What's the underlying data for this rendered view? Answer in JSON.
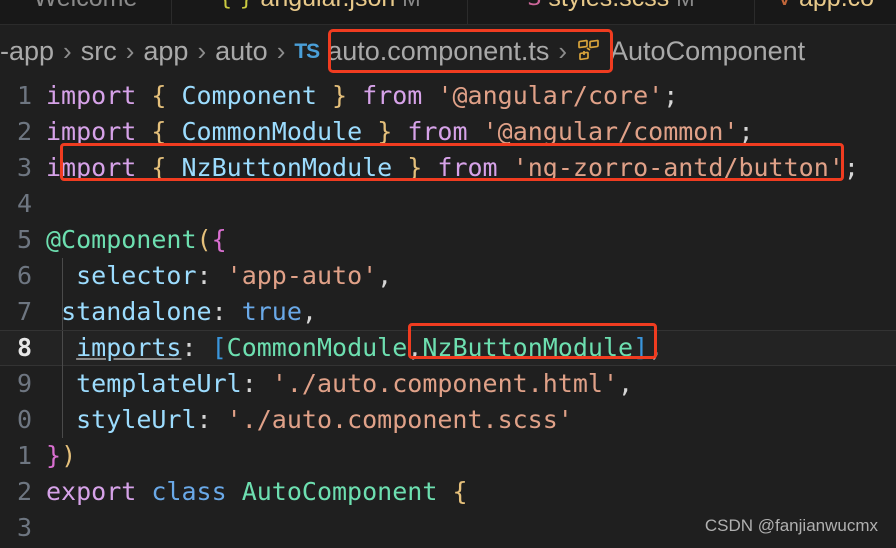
{
  "theme": {
    "editor_background": "#1f1f1f",
    "tabbar_background": "#181818",
    "highlight_box_color": "#f03c20",
    "current_line_background": "#232323",
    "keyword_color": "#d6a2e8",
    "type_color": "#6ddfb0",
    "string_color": "#e0a188",
    "identifier_color": "#9cdcfe",
    "brace_color": "#e5c07b",
    "bracket_color": "#3a96dd",
    "linenumber_color": "#6e7681"
  },
  "tabs": [
    {
      "label": "Welcome",
      "icon": "",
      "dirty": "",
      "active": false
    },
    {
      "label": "angular.json",
      "icon": "{ }",
      "dirty": "M",
      "active": false
    },
    {
      "label": "styles.scss",
      "icon": "S",
      "dirty": "M",
      "active": false
    },
    {
      "label": "app.co",
      "icon": "V",
      "dirty": "",
      "active": false
    }
  ],
  "breadcrumb": {
    "items": [
      "-app",
      "src",
      "app",
      "auto"
    ],
    "separator": "›",
    "file": {
      "badge": "TS",
      "name": "auto.component.ts"
    },
    "symbol": {
      "icon": "component-icon",
      "name": "AutoComponent"
    }
  },
  "code": {
    "lines": [
      {
        "n": "1",
        "current": false,
        "guide": false,
        "bulb": false
      },
      {
        "n": "2",
        "current": false,
        "guide": false,
        "bulb": false
      },
      {
        "n": "3",
        "current": false,
        "guide": false,
        "bulb": false
      },
      {
        "n": "4",
        "current": false,
        "guide": false,
        "bulb": false
      },
      {
        "n": "5",
        "current": false,
        "guide": false,
        "bulb": false
      },
      {
        "n": "6",
        "current": false,
        "guide": true,
        "bulb": false
      },
      {
        "n": "7",
        "current": false,
        "guide": true,
        "bulb": true
      },
      {
        "n": "8",
        "current": true,
        "guide": true,
        "bulb": false
      },
      {
        "n": "9",
        "current": false,
        "guide": true,
        "bulb": false
      },
      {
        "n": "0",
        "current": false,
        "guide": true,
        "bulb": false
      },
      {
        "n": "1",
        "current": false,
        "guide": false,
        "bulb": false
      },
      {
        "n": "2",
        "current": false,
        "guide": false,
        "bulb": false
      },
      {
        "n": "3",
        "current": false,
        "guide": false,
        "bulb": false
      }
    ],
    "text": {
      "l1": "import { Component } from '@angular/core';",
      "l2": "import { CommonModule } from '@angular/common';",
      "l3": "import { NzButtonModule } from 'ng-zorro-antd/button';",
      "l4": "",
      "l5": "@Component({",
      "l6": "  selector: 'app-auto',",
      "l7": " standalone: true,",
      "l8": "  imports: [CommonModule,NzButtonModule],",
      "l9": "  templateUrl: './auto.component.html',",
      "l10": "  styleUrl: './auto.component.scss'",
      "l11": "})",
      "l12": "export class AutoComponent {",
      "l13": "",
      "t_import": "import",
      "t_from": "from",
      "t_export": "export",
      "t_class": "class",
      "t_true": "true",
      "t_component": "Component",
      "t_commonmodule": "CommonModule",
      "t_nzbuttonmodule": "NzButtonModule",
      "t_autocomponent": "AutoComponent",
      "t_decorator": "@Component",
      "t_selector": "selector",
      "t_standalone": "standalone",
      "t_imports": "imports",
      "t_templateurl": "templateUrl",
      "t_styleurl": "styleUrl",
      "s_core": "'@angular/core'",
      "s_common": "'@angular/common'",
      "s_button": "'ng-zorro-antd/button'",
      "s_appauto": "'app-auto'",
      "s_html": "'./auto.component.html'",
      "s_scss": "'./auto.component.scss'",
      "p_lbrace": "{",
      "p_rbrace": "}",
      "p_semi": ";",
      "p_colon": ":",
      "p_comma": ",",
      "p_lparen": "(",
      "p_rparen": ")",
      "p_lbrack": "[",
      "p_rbrack": "]"
    }
  },
  "annotations": {
    "highlight_breadcrumb_file": "auto.component.ts",
    "highlight_import_line": "import { NzButtonModule } from 'ng-zorro-antd/button';",
    "highlight_imports_token": ",NzButtonModule],"
  },
  "watermark": "CSDN @fanjianwucmx"
}
